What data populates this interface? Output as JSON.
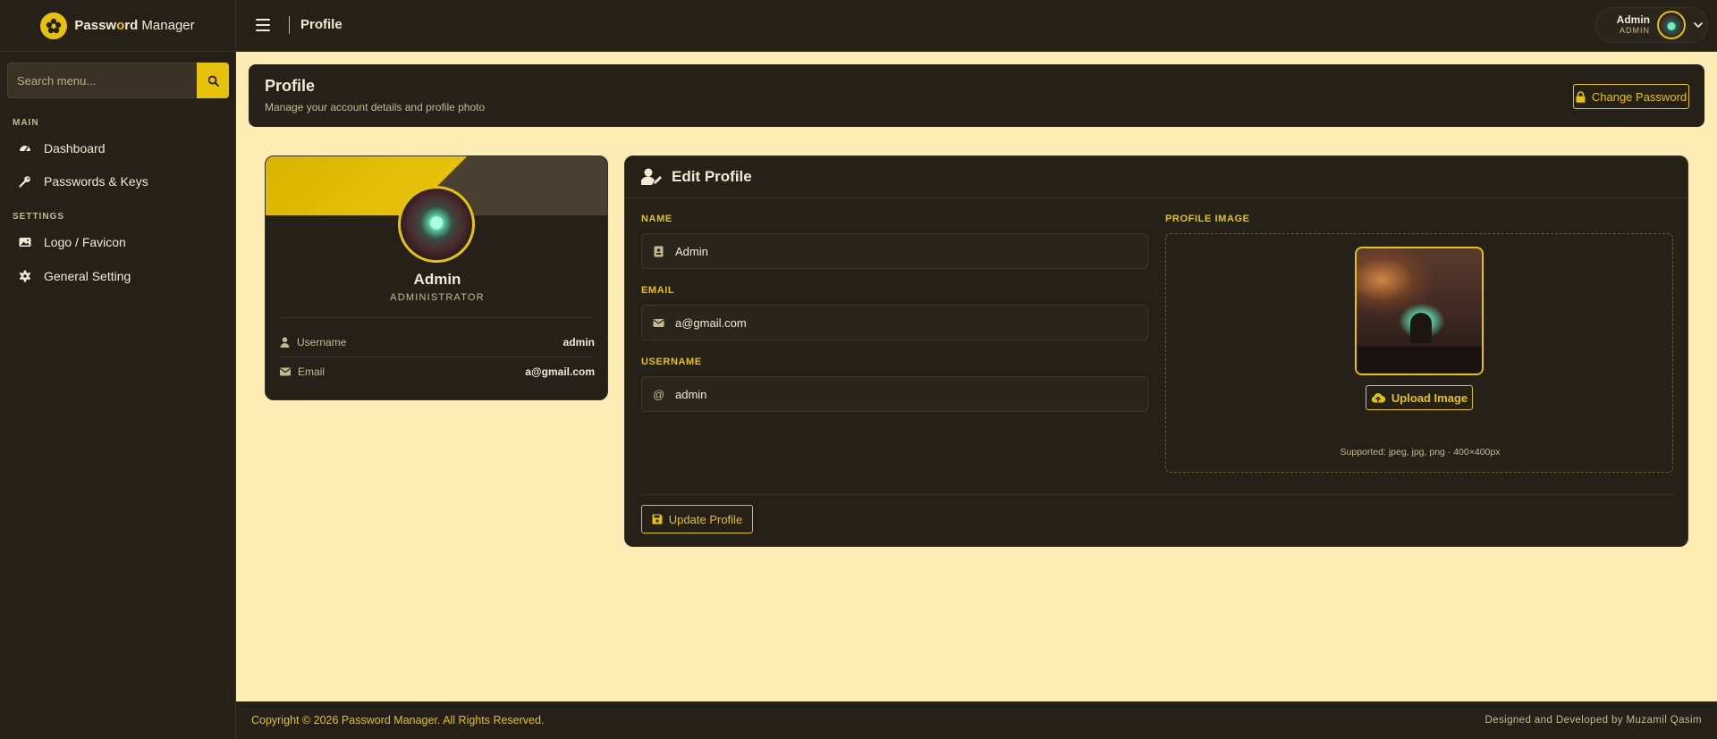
{
  "brand": {
    "name_prefix": "Passw",
    "name_o": "o",
    "name_rest": "rd",
    "name_suffix": " Manager"
  },
  "sidebar": {
    "search_placeholder": "Search menu...",
    "sections": [
      {
        "label": "MAIN",
        "items": [
          {
            "label": "Dashboard",
            "icon": "dashboard-icon"
          },
          {
            "label": "Passwords & Keys",
            "icon": "key-icon"
          }
        ]
      },
      {
        "label": "SETTINGS",
        "items": [
          {
            "label": "Logo / Favicon",
            "icon": "image-icon"
          },
          {
            "label": "General Setting",
            "icon": "gear-icon"
          }
        ]
      }
    ]
  },
  "topbar": {
    "title": "Profile",
    "user_name": "Admin",
    "user_role": "ADMIN"
  },
  "page_header": {
    "title": "Profile",
    "subtitle": "Manage your account details and profile photo",
    "change_password_label": "Change Password"
  },
  "profile_card": {
    "name": "Admin",
    "role": "ADMINISTRATOR",
    "rows": [
      {
        "label": "Username",
        "value": "admin"
      },
      {
        "label": "Email",
        "value": "a@gmail.com"
      }
    ]
  },
  "edit_profile": {
    "title": "Edit Profile",
    "name_label": "NAME",
    "name_value": "Admin",
    "email_label": "EMAIL",
    "email_value": "a@gmail.com",
    "username_label": "USERNAME",
    "username_value": "admin",
    "username_prefix": "@",
    "image_label": "PROFILE IMAGE",
    "upload_label": "Upload Image",
    "image_hint": "Supported: jpeg, jpg, png · 400×400px",
    "update_label": "Update Profile"
  },
  "footer": {
    "left": "Copyright © 2026 Password Manager. All Rights Reserved.",
    "right": "Designed and Developed by Muzamil Qasim"
  },
  "colors": {
    "accent": "#e6c20a",
    "panel": "#252119",
    "background": "#fdecb3",
    "text": "#f3ead3",
    "muted": "#c7b98f"
  }
}
